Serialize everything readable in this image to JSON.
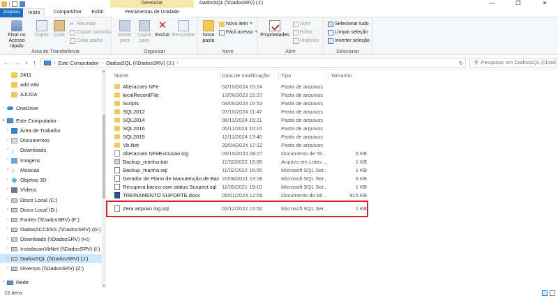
{
  "window": {
    "title": "DadosSQL (\\\\DadosSRV) (J:)",
    "context_header": "Gerenciar",
    "controls": {
      "minimize": "—",
      "maximize": "❐",
      "close": "✕"
    }
  },
  "tabs": {
    "arquivo": "Arquivo",
    "inicio": "Início",
    "compartilhar": "Compartilhar",
    "exibir": "Exibir",
    "ferramentas": "Ferramentas de Unidade"
  },
  "ribbon": {
    "clipboard": {
      "label": "Área de Transferência",
      "pin": "Fixar no Acesso rápido",
      "copy": "Copiar",
      "paste": "Colar",
      "cut": "Recortar",
      "copy_path": "Copiar caminho",
      "paste_shortcut": "Colar atalho"
    },
    "organize": {
      "label": "Organizar",
      "move": "Mover para",
      "copy_to": "Copiar para",
      "delete": "Excluir",
      "rename": "Renomear"
    },
    "new": {
      "label": "Novo",
      "new_folder": "Nova pasta",
      "new_item": "Novo item",
      "easy_access": "Fácil acesso"
    },
    "open": {
      "label": "Abrir",
      "properties": "Propriedades",
      "open": "Abrir",
      "edit": "Editar",
      "history": "Histórico"
    },
    "select": {
      "label": "Selecionar",
      "select_all": "Selecionar tudo",
      "clear": "Limpar seleção",
      "invert": "Inverter seleção"
    }
  },
  "address": {
    "root": "Este Computador",
    "current": "DadosSQL (\\\\DadosSRV) (J:)",
    "search_placeholder": "Pesquisar em DadosSQL (\\\\DadosSRV) (J:)"
  },
  "nav": {
    "items": [
      {
        "label": "2411",
        "icon": "folder"
      },
      {
        "label": "add wiki",
        "icon": "folder"
      },
      {
        "label": "AJUDA",
        "icon": "folder"
      },
      {
        "label": "OneDrive",
        "icon": "cloud"
      },
      {
        "label": "Este Computador",
        "icon": "pc"
      },
      {
        "label": "Área de Trabalho",
        "icon": "desktop"
      },
      {
        "label": "Documentos",
        "icon": "documents"
      },
      {
        "label": "Downloads",
        "icon": "downloads"
      },
      {
        "label": "Imagens",
        "icon": "images"
      },
      {
        "label": "Músicas",
        "icon": "music"
      },
      {
        "label": "Objetos 3D",
        "icon": "3d"
      },
      {
        "label": "Vídeos",
        "icon": "videos"
      },
      {
        "label": "Disco Local (C:)",
        "icon": "disk"
      },
      {
        "label": "Disco Local (D:)",
        "icon": "disk"
      },
      {
        "label": "Fontes (\\\\DadosSRV) (F:)",
        "icon": "netdrive"
      },
      {
        "label": "DadosACCESS (\\\\DadosSRV) (G:)",
        "icon": "netdrive"
      },
      {
        "label": "Downloads (\\\\DadosSRV) (H:)",
        "icon": "netdrive"
      },
      {
        "label": "InstalacaoVbNet (\\\\DadosSRV) (I:)",
        "icon": "netdrive"
      },
      {
        "label": "DadosSQL (\\\\DadosSRV) (J:)",
        "icon": "netdrive",
        "selected": true
      },
      {
        "label": "Diversos (\\\\DadosSRV) (Z:)",
        "icon": "netdrive"
      },
      {
        "label": "Rede",
        "icon": "network"
      }
    ]
  },
  "columns": {
    "name": "Nome",
    "date": "Data de modificação",
    "type": "Tipo",
    "size": "Tamanho"
  },
  "files": [
    {
      "name": "Alteracoes NFe",
      "date": "02/10/2024 15:24",
      "type": "Pasta de arquivos",
      "size": "",
      "kind": "folder"
    },
    {
      "name": "localRecordFile",
      "date": "13/06/2023 15:37",
      "type": "Pasta de arquivos",
      "size": "",
      "kind": "folder"
    },
    {
      "name": "Scripts",
      "date": "04/06/2024 16:53",
      "type": "Pasta de arquivos",
      "size": "",
      "kind": "folder"
    },
    {
      "name": "SQL2012",
      "date": "07/10/2024 11:47",
      "type": "Pasta de arquivos",
      "size": "",
      "kind": "folder"
    },
    {
      "name": "SQL2014",
      "date": "06/11/2024 15:21",
      "type": "Pasta de arquivos",
      "size": "",
      "kind": "folder"
    },
    {
      "name": "SQL2016",
      "date": "05/11/2024 10:16",
      "type": "Pasta de arquivos",
      "size": "",
      "kind": "folder"
    },
    {
      "name": "SQL2019",
      "date": "12/11/2024 13:40",
      "type": "Pasta de arquivos",
      "size": "",
      "kind": "folder"
    },
    {
      "name": "Vb.Net",
      "date": "29/04/2024 17:12",
      "type": "Pasta de arquivos",
      "size": "",
      "kind": "folder"
    },
    {
      "name": "Alteracoes NFeExclusao.log",
      "date": "03/10/2024 08:27",
      "type": "Documento de Te...",
      "size": "5 KB",
      "kind": "file"
    },
    {
      "name": "Backup_manha.bat",
      "date": "11/02/2022 16:08",
      "type": "Arquivo em Lotes ...",
      "size": "1 KB",
      "kind": "bat"
    },
    {
      "name": "Backup_manha.sql",
      "date": "11/02/2022 16:05",
      "type": "Microsoft SQL Ser...",
      "size": "1 KB",
      "kind": "sql"
    },
    {
      "name": "Gerador de Plano de Manutenção de Ban...",
      "date": "20/08/2021 19:36",
      "type": "Microsoft SQL Ser...",
      "size": "6 KB",
      "kind": "sql"
    },
    {
      "name": "Recupera banco com status Suspect.sql",
      "date": "11/05/2021 19:10",
      "type": "Microsoft SQL Ser...",
      "size": "1 KB",
      "kind": "sql"
    },
    {
      "name": "TREINAMENTO SUPORTE.docx",
      "date": "05/01/2024 12:59",
      "type": "Documento do Mi...",
      "size": "915 KB",
      "kind": "docx"
    },
    {
      "name": "Zera arquivo log.sql",
      "date": "02/12/2022 15:50",
      "type": "Microsoft SQL Ser...",
      "size": "1 KB",
      "kind": "sql",
      "highlighted": true
    }
  ],
  "status": {
    "count": "15 itens"
  },
  "colors": {
    "accent": "#1a6fc4",
    "selection": "#cce8ff",
    "highlight_box": "#e02020",
    "folder": "#f2c75c"
  }
}
